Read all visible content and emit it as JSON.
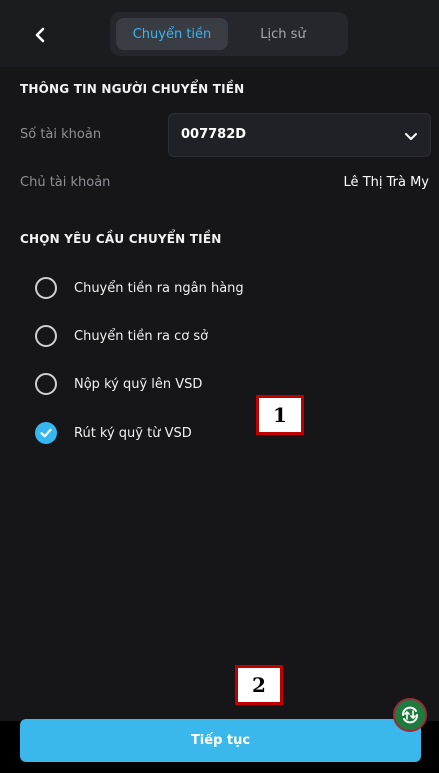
{
  "header": {
    "tabs": [
      {
        "label": "Chuyển tiền",
        "active": true
      },
      {
        "label": "Lịch sử",
        "active": false
      }
    ]
  },
  "sender": {
    "section_title": "THÔNG TIN NGƯỜI CHUYỂN TIỀN",
    "account_number_label": "Số tài khoản",
    "account_number_value": "007782D",
    "account_owner_label": "Chủ tài khoản",
    "account_owner_value": "Lê Thị Trà My"
  },
  "request": {
    "section_title": "CHỌN YÊU CẦU CHUYỂN TIỀN",
    "options": [
      {
        "label": "Chuyển tiền ra ngân hàng",
        "selected": false
      },
      {
        "label": "Chuyển tiền ra cơ sở",
        "selected": false
      },
      {
        "label": "Nộp ký quỹ lên VSD",
        "selected": false
      },
      {
        "label": "Rút ký quỹ từ VSD",
        "selected": true
      }
    ]
  },
  "annotations": {
    "marker_1": "1",
    "marker_2": "2"
  },
  "footer": {
    "continue_label": "Tiếp tục"
  },
  "colors": {
    "accent": "#36b6ef",
    "button": "#3ab7eb",
    "background": "#161619",
    "marker_border": "#c00000"
  },
  "icons": {
    "back": "chevron-left-icon",
    "dropdown": "chevron-down-icon",
    "checked": "check-circle-icon",
    "floating": "refresh-transfer-icon"
  }
}
